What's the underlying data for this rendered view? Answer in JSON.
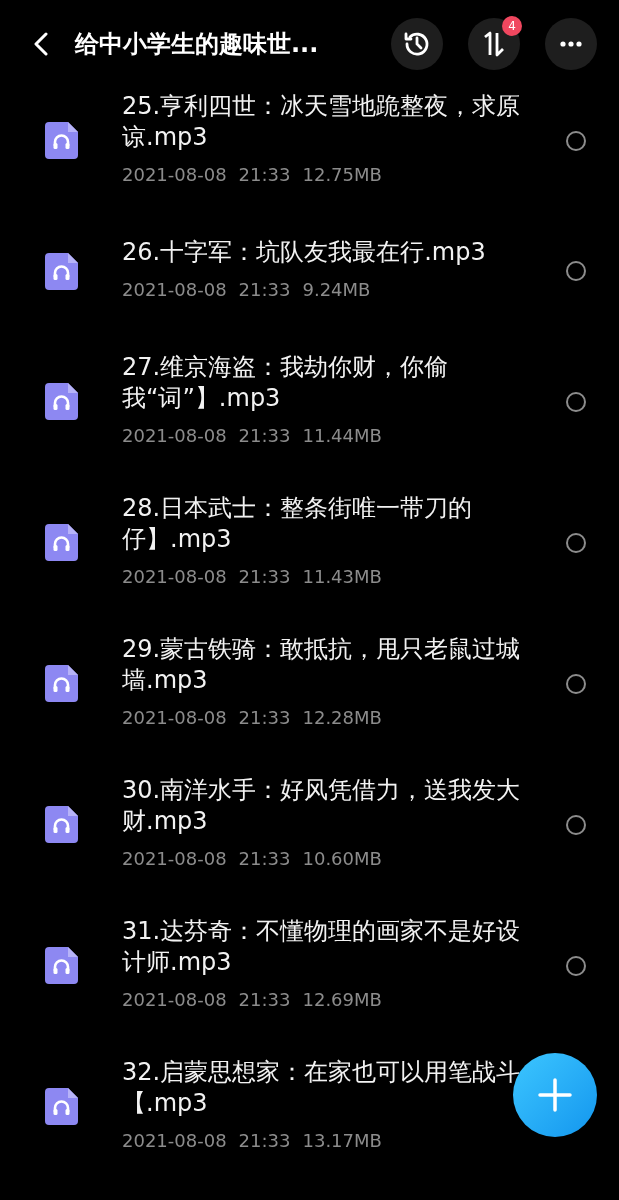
{
  "header": {
    "title": "给中小学生的趣味世...",
    "sort_badge": "4"
  },
  "files": [
    {
      "name_lines": [
        "25.亨利四世：冰天雪地跪整夜，求原",
        "谅.mp3"
      ],
      "date": "2021-08-08",
      "time": "21:33",
      "size": "12.75MB",
      "selected": false
    },
    {
      "name_lines": [
        "26.十字军：坑队友我最在行.mp3"
      ],
      "date": "2021-08-08",
      "time": "21:33",
      "size": "9.24MB",
      "selected": false
    },
    {
      "name_lines": [
        "27.维京海盗：我劫你财，你偷",
        "我“词”】.mp3"
      ],
      "date": "2021-08-08",
      "time": "21:33",
      "size": "11.44MB",
      "selected": false
    },
    {
      "name_lines": [
        "28.日本武士：整条街唯一带刀的",
        "仔】.mp3"
      ],
      "date": "2021-08-08",
      "time": "21:33",
      "size": "11.43MB",
      "selected": false
    },
    {
      "name_lines": [
        "29.蒙古铁骑：敢抵抗，甩只老鼠过城",
        "墙.mp3"
      ],
      "date": "2021-08-08",
      "time": "21:33",
      "size": "12.28MB",
      "selected": false
    },
    {
      "name_lines": [
        "30.南洋水手：好风凭借力，送我发大",
        "财.mp3"
      ],
      "date": "2021-08-08",
      "time": "21:33",
      "size": "10.60MB",
      "selected": false
    },
    {
      "name_lines": [
        "31.达芬奇：不懂物理的画家不是好设",
        "计师.mp3"
      ],
      "date": "2021-08-08",
      "time": "21:33",
      "size": "12.69MB",
      "selected": false
    },
    {
      "name_lines": [
        "32.启蒙思想家：在家也可以用笔战斗",
        "【.mp3"
      ],
      "date": "2021-08-08",
      "time": "21:33",
      "size": "13.17MB"
    }
  ]
}
